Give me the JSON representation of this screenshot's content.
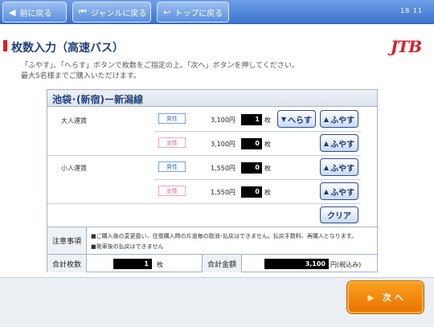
{
  "nav": {
    "back": "前に戻る",
    "genre": "ジャンルに戻る",
    "top": "トップに戻る",
    "clock": "18 11"
  },
  "header": {
    "title": "枚数入力（高速バス）",
    "logo": "JTB",
    "instruction_1": "「ふやす」、「へらす」ボタンで枚数をご指定の上、「次へ」ボタンを押してください。",
    "instruction_2": "最大5名様までご購入いただけます。"
  },
  "route": "池袋･(新宿)ー新潟線",
  "fares": {
    "adult_label": "大人運賃",
    "child_label": "小人運賃",
    "male": "男性",
    "female": "女性",
    "unit": "枚",
    "rows": [
      {
        "price": "3,100円",
        "count": "1"
      },
      {
        "price": "3,100円",
        "count": "0"
      },
      {
        "price": "1,550円",
        "count": "0"
      },
      {
        "price": "1,550円",
        "count": "0"
      }
    ],
    "decrease": "へらす",
    "increase": "ふやす",
    "clear": "クリア"
  },
  "notes": {
    "label": "注意事項",
    "line1": "■ご購入後の変更扱い、往復購入時の片道毎の取消･払戻はできません。払戻手数料、再購入となります。",
    "line2": "■発車後の払戻はできません"
  },
  "totals": {
    "count_label": "合計枚数",
    "count_value": "1",
    "count_unit": "枚",
    "amount_label": "合計金額",
    "amount_value": "3,100",
    "amount_unit": "円(税込み)"
  },
  "footer": {
    "next": "次 へ"
  },
  "colors": {
    "nav_blue": "#3e74cf",
    "title_blue": "#1f3f7a",
    "brand_red": "#d8202a",
    "next_orange": "#ea7400"
  }
}
